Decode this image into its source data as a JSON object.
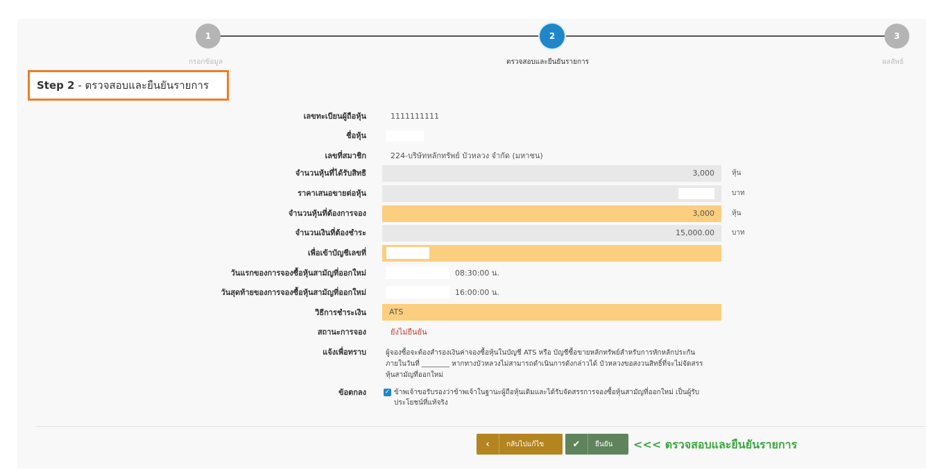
{
  "stepper": {
    "steps": [
      {
        "number": "1",
        "label": "กรอกข้อมูล",
        "state": "done"
      },
      {
        "number": "2",
        "label": "ตรวจสอบและยืนยันรายการ",
        "state": "active"
      },
      {
        "number": "3",
        "label": "ผลลัพธ์",
        "state": "todo"
      }
    ]
  },
  "heading": {
    "step": "Step 2",
    "separator": " - ",
    "title": "ตรวจสอบและยืนยันรายการ"
  },
  "form": {
    "shareholder_reg_no": {
      "label": "เลขทะเบียนผู้ถือหุ้น",
      "value": "1111111111"
    },
    "stock_name": {
      "label": "ชื่อหุ้น",
      "value": ""
    },
    "member_no": {
      "label": "เลขที่สมาชิก",
      "value": "224-บริษัทหลักทรัพย์ บัวหลวง จำกัด (มหาชน)"
    },
    "entitled_shares": {
      "label": "จำนวนหุ้นที่ได้รับสิทธิ",
      "value": "3,000",
      "unit": "หุ้น"
    },
    "offer_price": {
      "label": "ราคาเสนอขายต่อหุ้น",
      "value": "",
      "unit": "บาท"
    },
    "shares_to_subscribe": {
      "label": "จำนวนหุ้นที่ต้องการจอง",
      "value": "3,000",
      "unit": "หุ้น"
    },
    "amount_to_pay": {
      "label": "จำนวนเงินที่ต้องชำระ",
      "value": "15,000.00",
      "unit": "บาท"
    },
    "account_no": {
      "label": "เพื่อเข้าบัญชีเลขที่",
      "value": ""
    },
    "first_day": {
      "label": "วันแรกของการจองซื้อหุ้นสามัญที่ออกใหม่",
      "value": "08:30:00 น."
    },
    "last_day": {
      "label": "วันสุดท้ายของการจองซื้อหุ้นสามัญที่ออกใหม่",
      "value": "16:00:00 น."
    },
    "payment_method": {
      "label": "วิธีการชำระเงิน",
      "value": "ATS"
    },
    "status": {
      "label": "สถานะการจอง",
      "value": "ยังไม่ยืนยัน"
    },
    "notice": {
      "label": "แจ้งเพื่อทราบ",
      "text": "ผู้จองซื้อจะต้องสำรองเงินค่าจองซื้อหุ้นในบัญชี ATS หรือ บัญชีซื้อขายหลักทรัพย์สำหรับการหักหลักประกัน ภายในวันที่ ________ หากทางบัวหลวงไม่สามารถดำเนินการดังกล่าวได้ บัวหลวงขอสงวนสิทธิ์ที่จะไม่จัดสรรหุ้นสามัญที่ออกใหม่"
    },
    "agreement": {
      "label": "ข้อตกลง",
      "text": "ข้าพเจ้าขอรับรองว่าข้าพเจ้าในฐานะผู้ถือหุ้นเดิมและได้รับจัดสรรการจองซื้อหุ้นสามัญที่ออกใหม่ เป็นผู้รับประโยชน์ที่แท้จริง",
      "checked": true
    }
  },
  "buttons": {
    "back": "กลับไปแก้ไข",
    "confirm": "ยืนยัน"
  },
  "callout": "<<< ตรวจสอบและยืนยันรายการ",
  "colors": {
    "accent_blue": "#1f86c9",
    "highlight_yellow": "#fbcf7f",
    "step_frame_orange": "#f07c24",
    "callout_green": "#3aa83f",
    "status_red": "#c0392b"
  }
}
